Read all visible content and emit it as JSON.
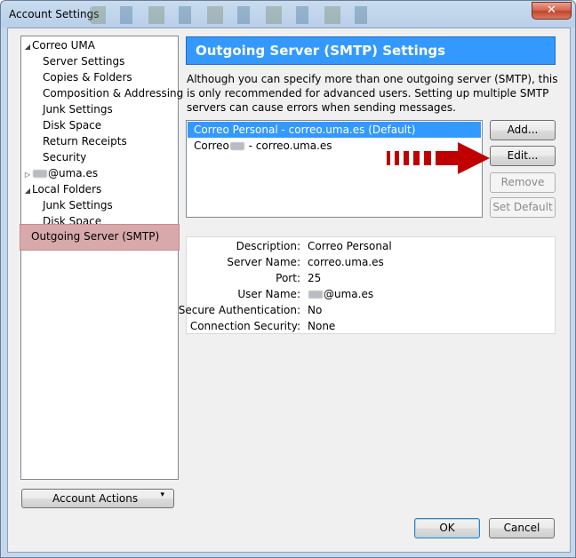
{
  "window": {
    "title": "Account Settings",
    "close_glyph": "✕"
  },
  "tree": {
    "root1": {
      "label": "Correo UMA",
      "twisty": "◢"
    },
    "root1_children": [
      "Server Settings",
      "Copies & Folders",
      "Composition & Addressing",
      "Junk Settings",
      "Disk Space",
      "Return Receipts",
      "Security"
    ],
    "root2": {
      "suffix": "@uma.es",
      "twisty": "▷"
    },
    "root3": {
      "label": "Local Folders",
      "twisty": "◢"
    },
    "root3_children": [
      "Junk Settings",
      "Disk Space"
    ],
    "selected": "Outgoing Server (SMTP)"
  },
  "account_actions": {
    "label": "Account Actions",
    "arrow": "▾"
  },
  "panel": {
    "title": "Outgoing Server (SMTP) Settings",
    "intro": "Although you can specify more than one outgoing server (SMTP), this is only recommended for advanced users. Setting up multiple SMTP servers can cause errors when sending messages."
  },
  "servers": {
    "row1": "Correo Personal - correo.uma.es (Default)",
    "row2_prefix": "Correo",
    "row2_suffix": " - correo.uma.es"
  },
  "buttons": {
    "add": "Add...",
    "edit": "Edit...",
    "remove": "Remove",
    "set_default": "Set Default",
    "ok": "OK",
    "cancel": "Cancel"
  },
  "details": {
    "description_label": "Description:",
    "description_value": "Correo Personal",
    "server_name_label": "Server Name:",
    "server_name_value": "correo.uma.es",
    "port_label": "Port:",
    "port_value": "25",
    "user_name_label": "User Name:",
    "user_name_suffix": "@uma.es",
    "secure_auth_label": "Secure Authentication:",
    "secure_auth_value": "No",
    "conn_security_label": "Connection Security:",
    "conn_security_value": "None"
  },
  "colors": {
    "selection": "#3399ff",
    "tree_highlight": "#d7a9aa",
    "arrow": "#c00000"
  }
}
